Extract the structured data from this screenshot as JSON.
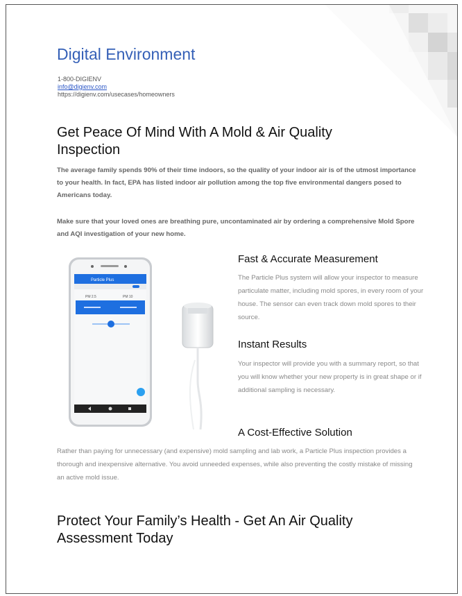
{
  "header": {
    "company_name": "Digital Environment",
    "phone": "1-800-DIGIENV",
    "email": "info@digienv.com",
    "url": "https://digienv.com/usecases/homeowners"
  },
  "intro": {
    "heading": "Get Peace Of Mind With A Mold & Air Quality Inspection",
    "paragraph_1": "The average family spends 90% of their time indoors, so the quality of your indoor air is of the utmost importance to your health. In fact, EPA has listed indoor air pollution among the top five environmental dangers posed to Americans today.",
    "paragraph_2": "Make sure that your loved ones are breathing pure, uncontaminated air by ordering a comprehensive Mold Spore and AQI investigation of your new home."
  },
  "features": [
    {
      "heading": "Fast & Accurate Measurement",
      "text": "The Particle Plus system will allow your inspector to measure particulate matter, including mold spores, in every room of your house. The sensor can even track down mold spores to their source."
    },
    {
      "heading": "Instant Results",
      "text": "Your inspector will provide you with a summary report, so that you will know whether your new property is in great shape or if additional sampling is necessary."
    },
    {
      "heading": "A Cost-Effective Solution",
      "text": "Rather than paying for unnecessary (and expensive) mold sampling and lab work, a Particle Plus inspection provides a thorough and inexpensive alternative. You avoid unneeded expenses, while also preventing the costly mistake of missing an active mold issue."
    }
  ],
  "phone_app": {
    "title": "Particle Plus",
    "pm_labels": [
      "PM 2.5",
      "PM 10"
    ]
  },
  "closing": {
    "heading": "Protect Your Family’s Health - Get An Air Quality Assessment Today"
  },
  "colors": {
    "brand_blue": "#3560b7",
    "link_blue": "#2a56c6",
    "app_blue": "#1e6fe0"
  }
}
